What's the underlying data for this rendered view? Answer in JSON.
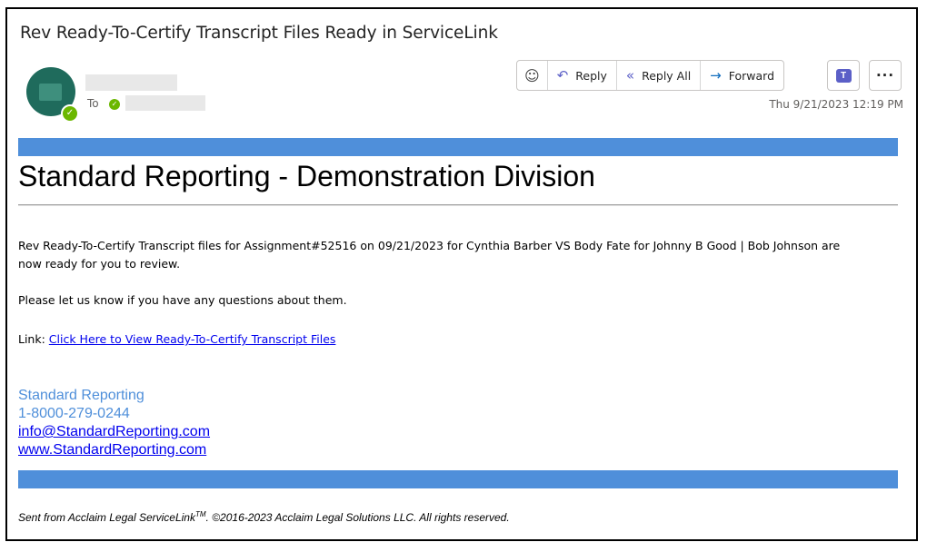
{
  "message": {
    "subject": "Rev Ready-To-Certify Transcript Files Ready in ServiceLink",
    "to_label": "To",
    "timestamp": "Thu 9/21/2023 12:19 PM"
  },
  "toolbar": {
    "emoji_icon": "smiley-icon",
    "reply_label": "Reply",
    "reply_all_label": "Reply All",
    "forward_label": "Forward",
    "teams_icon": "teams-icon",
    "more_icon": "more-icon",
    "more_glyph": "···"
  },
  "body": {
    "heading": "Standard Reporting - Demonstration Division",
    "paragraph1": "Rev Ready-To-Certify Transcript files for Assignment#52516 on 09/21/2023 for Cynthia Barber VS Body Fate for Johnny B Good | Bob Johnson are now ready for you to review.",
    "paragraph2": "Please let us know if you have any questions about them.",
    "link_prefix": "Link: ",
    "link_text": "Click Here to View Ready-To-Certify Transcript Files"
  },
  "signature": {
    "company": "Standard Reporting",
    "phone": "1-8000-279-0244",
    "email": "info@StandardReporting.com",
    "website": "www.StandardReporting.com"
  },
  "footer": {
    "text_before_tm": "Sent from Acclaim Legal ServiceLink",
    "tm": "TM",
    "text_after_tm": ".   ©2016-2023 Acclaim Legal Solutions LLC. All rights reserved."
  },
  "colors": {
    "accent_bar": "#4f8fda",
    "avatar": "#1f6b5c",
    "presence": "#6bb700",
    "link": "#0000ee"
  }
}
